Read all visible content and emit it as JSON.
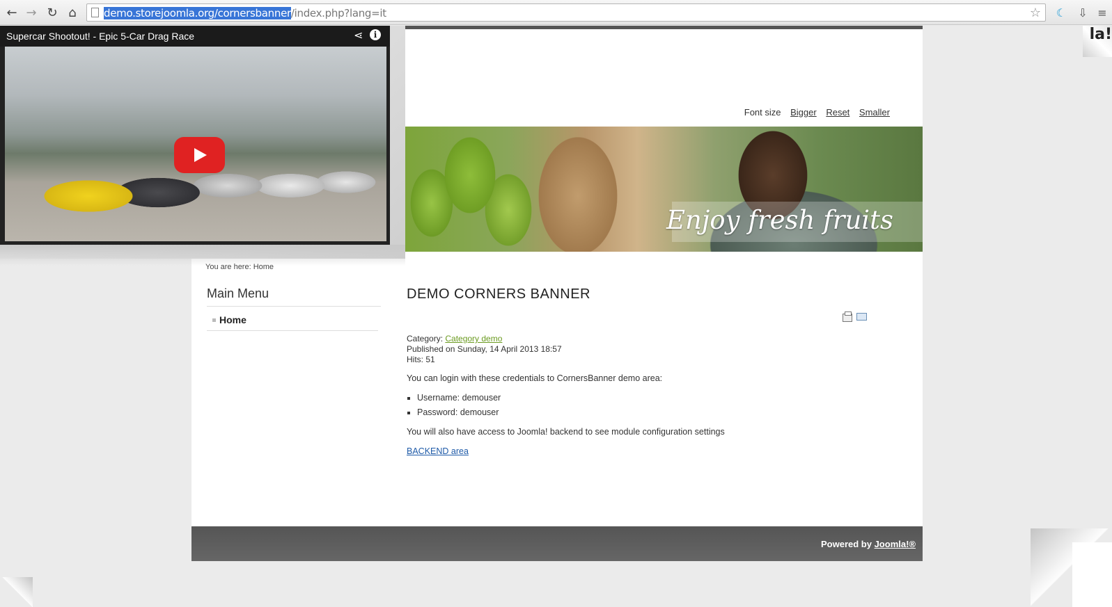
{
  "browser": {
    "url_selected": "demo.storejoomla.org/cornersbanner",
    "url_rest": "/index.php?lang=it"
  },
  "font_size": {
    "label": "Font size",
    "bigger": "Bigger",
    "reset": "Reset",
    "smaller": "Smaller"
  },
  "banner": {
    "caption": "Enjoy fresh fruits"
  },
  "breadcrumb": "You are here: Home",
  "main_menu": {
    "title": "Main Menu",
    "items": [
      {
        "label": "Home"
      }
    ]
  },
  "article": {
    "title": "DEMO CORNERS BANNER",
    "category_label": "Category: ",
    "category_link": "Category demo",
    "published": "Published on Sunday, 14 April 2013 18:57",
    "hits": "Hits: 51",
    "intro": "You can login with these credentials to CornersBanner demo area:",
    "credentials": [
      "Username: demouser",
      "Password: demouser"
    ],
    "note": "You will also have access to Joomla! backend to see module configuration settings",
    "backend_link": "BACKEND area"
  },
  "footer": {
    "powered_by": "Powered by ",
    "joomla_link": "Joomla!®"
  },
  "video": {
    "title": "Supercar Shootout! - Epic 5-Car Drag Race"
  },
  "corner_peel": {
    "text": "la!"
  },
  "colors": {
    "link_green": "#6a9a1f",
    "link_blue": "#1e5aa8",
    "footer_bg": "#5b5b5b",
    "youtube_red": "#e02222"
  }
}
